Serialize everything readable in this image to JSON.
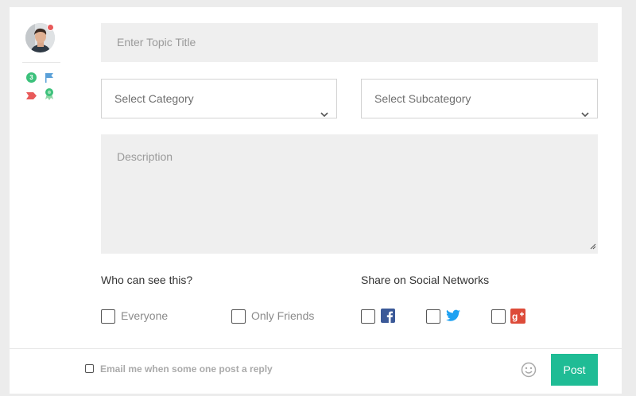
{
  "author": {
    "badge_count": "3"
  },
  "form": {
    "topic_placeholder": "Enter Topic Title",
    "category_selected": "Select Category",
    "subcategory_selected": "Select Subcategory",
    "description_placeholder": "Description",
    "visibility": {
      "label": "Who can see this?",
      "options": [
        "Everyone",
        "Only Friends"
      ]
    },
    "share": {
      "label": "Share on Social Networks",
      "networks": [
        "facebook-icon",
        "twitter-icon",
        "google-plus-icon"
      ]
    }
  },
  "footer": {
    "email_label": "Email me when some one post a reply",
    "post_label": "Post"
  },
  "colors": {
    "accent": "#1fbc95",
    "status": "#e85a5a",
    "badge": "#3cc17b",
    "facebook": "#3b5998",
    "twitter": "#1da1f2",
    "google_plus": "#dd4b39"
  }
}
